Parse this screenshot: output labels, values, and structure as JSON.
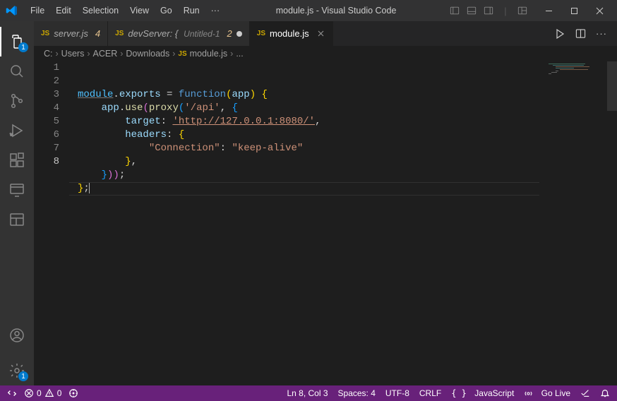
{
  "title": "module.js - Visual Studio Code",
  "menu": [
    "File",
    "Edit",
    "Selection",
    "View",
    "Go",
    "Run",
    "···"
  ],
  "activity_badges": {
    "explorer": "1",
    "settings": "1"
  },
  "tabs": [
    {
      "icon": "JS",
      "label": "server.js",
      "badge": "4",
      "dirty": false,
      "active": false
    },
    {
      "icon": "JS",
      "label": "devServer: {",
      "suffix": "Untitled-1",
      "badge": "2",
      "dirty": true,
      "active": false
    },
    {
      "icon": "JS",
      "label": "module.js",
      "dirty": false,
      "active": true
    }
  ],
  "breadcrumb": [
    "C:",
    "Users",
    "ACER",
    "Downloads",
    "module.js",
    "..."
  ],
  "breadcrumb_icon_at": 4,
  "code_tokens": [
    [
      [
        "tk-ident underline",
        "module"
      ],
      [
        "tk-punc",
        "."
      ],
      [
        "tk-prop",
        "exports"
      ],
      [
        "tk-punc",
        " = "
      ],
      [
        "tk-key",
        "function"
      ],
      [
        "tk-paren1",
        "("
      ],
      [
        "tk-prop",
        "app"
      ],
      [
        "tk-paren1",
        ")"
      ],
      [
        "tk-punc",
        " "
      ],
      [
        "tk-paren1",
        "{"
      ]
    ],
    [
      [
        "tk-prop",
        "    app"
      ],
      [
        "tk-punc",
        "."
      ],
      [
        "tk-fn",
        "use"
      ],
      [
        "tk-paren2",
        "("
      ],
      [
        "tk-fn",
        "proxy"
      ],
      [
        "tk-paren3",
        "("
      ],
      [
        "tk-str",
        "'/api'"
      ],
      [
        "tk-punc",
        ", "
      ],
      [
        "tk-paren3",
        "{"
      ]
    ],
    [
      [
        "tk-prop",
        "        target"
      ],
      [
        "tk-punc",
        ": "
      ],
      [
        "tk-url",
        "'http://127.0.0.1:8080/'"
      ],
      [
        "tk-punc",
        ","
      ]
    ],
    [
      [
        "tk-prop",
        "        headers"
      ],
      [
        "tk-punc",
        ": "
      ],
      [
        "tk-paren1",
        "{"
      ]
    ],
    [
      [
        "tk-str",
        "            \"Connection\""
      ],
      [
        "tk-punc",
        ": "
      ],
      [
        "tk-str",
        "\"keep-alive\""
      ]
    ],
    [
      [
        "tk-punc",
        "        "
      ],
      [
        "tk-paren1",
        "}"
      ],
      [
        "tk-punc",
        ","
      ]
    ],
    [
      [
        "tk-punc",
        "    "
      ],
      [
        "tk-paren3",
        "}"
      ],
      [
        "tk-paren2",
        ")"
      ],
      [
        "tk-paren2",
        ")"
      ],
      [
        "tk-punc",
        ";"
      ]
    ],
    [
      [
        "tk-paren1",
        "}"
      ],
      [
        "tk-punc",
        ";"
      ],
      [
        "cursor",
        ""
      ]
    ]
  ],
  "current_line": 8,
  "status": {
    "remote": "",
    "errors": "0",
    "warnings": "0",
    "lncol": "Ln 8, Col 3",
    "spaces": "Spaces: 4",
    "encoding": "UTF-8",
    "eol": "CRLF",
    "lang": "JavaScript",
    "golive": "Go Live"
  }
}
